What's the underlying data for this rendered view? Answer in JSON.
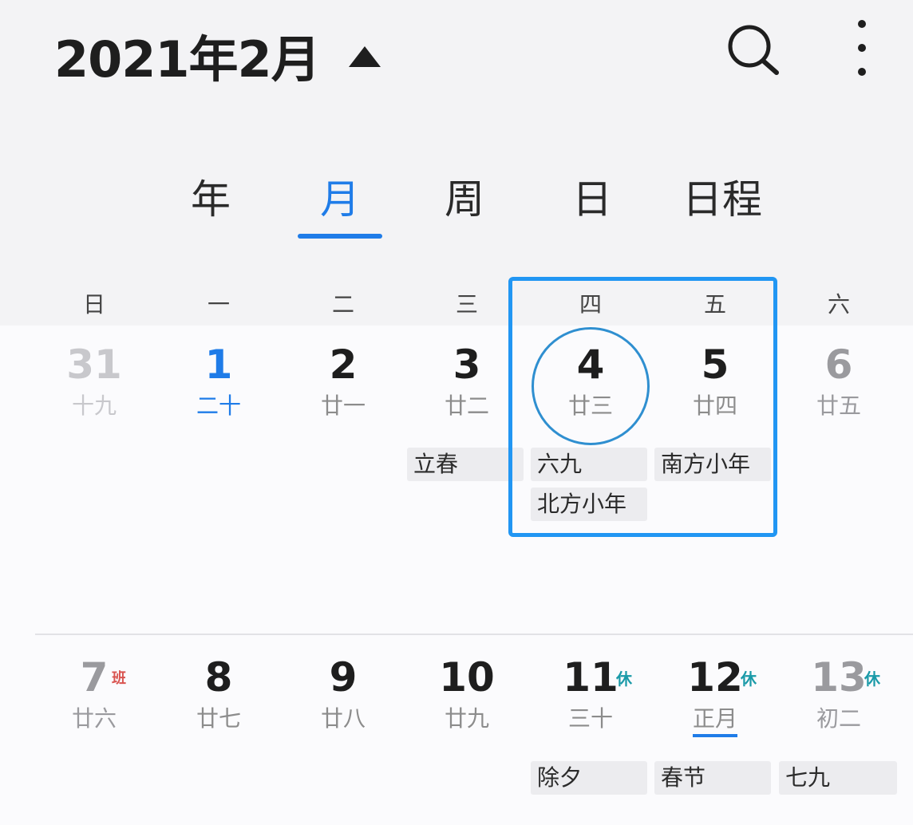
{
  "header": {
    "title": "2021年2月",
    "search_icon": "search-icon",
    "menu_icon": "more-vertical-icon"
  },
  "tabs": [
    {
      "label": "年"
    },
    {
      "label": "月"
    },
    {
      "label": "周"
    },
    {
      "label": "日"
    },
    {
      "label": "日程"
    }
  ],
  "active_tab": "月",
  "weekdays": [
    "日",
    "一",
    "二",
    "三",
    "四",
    "五",
    "六"
  ],
  "weeks": [
    {
      "days": [
        {
          "num": "31",
          "lunar": "十九",
          "style": "muted"
        },
        {
          "num": "1",
          "lunar": "二十",
          "style": "today"
        },
        {
          "num": "2",
          "lunar": "廿一"
        },
        {
          "num": "3",
          "lunar": "廿二"
        },
        {
          "num": "4",
          "lunar": "廿三",
          "style": "selected"
        },
        {
          "num": "5",
          "lunar": "廿四"
        },
        {
          "num": "6",
          "lunar": "廿五",
          "style": "sat"
        }
      ],
      "events": [
        {
          "day": 3,
          "text": "立春"
        },
        {
          "day": 4,
          "text": "六九"
        },
        {
          "day": 5,
          "text": "南方小年"
        },
        {
          "day": 4,
          "text": "北方小年"
        }
      ]
    },
    {
      "days": [
        {
          "num": "7",
          "lunar": "廿六",
          "badge": "班",
          "style": "sat"
        },
        {
          "num": "8",
          "lunar": "廿七"
        },
        {
          "num": "9",
          "lunar": "廿八"
        },
        {
          "num": "10",
          "lunar": "廿九"
        },
        {
          "num": "11",
          "lunar": "三十",
          "badge": "休"
        },
        {
          "num": "12",
          "lunar": "正月",
          "badge": "休",
          "lunar_underline": true
        },
        {
          "num": "13",
          "lunar": "初二",
          "badge": "休",
          "style": "sat"
        }
      ],
      "events": [
        {
          "day": 4,
          "text": "除夕"
        },
        {
          "day": 5,
          "text": "春节"
        },
        {
          "day": 6,
          "text": "七九"
        }
      ]
    }
  ],
  "colors": {
    "accent": "#1f7ce8",
    "rest_badge": "#1a9aa8",
    "work_badge": "#d9534f"
  }
}
